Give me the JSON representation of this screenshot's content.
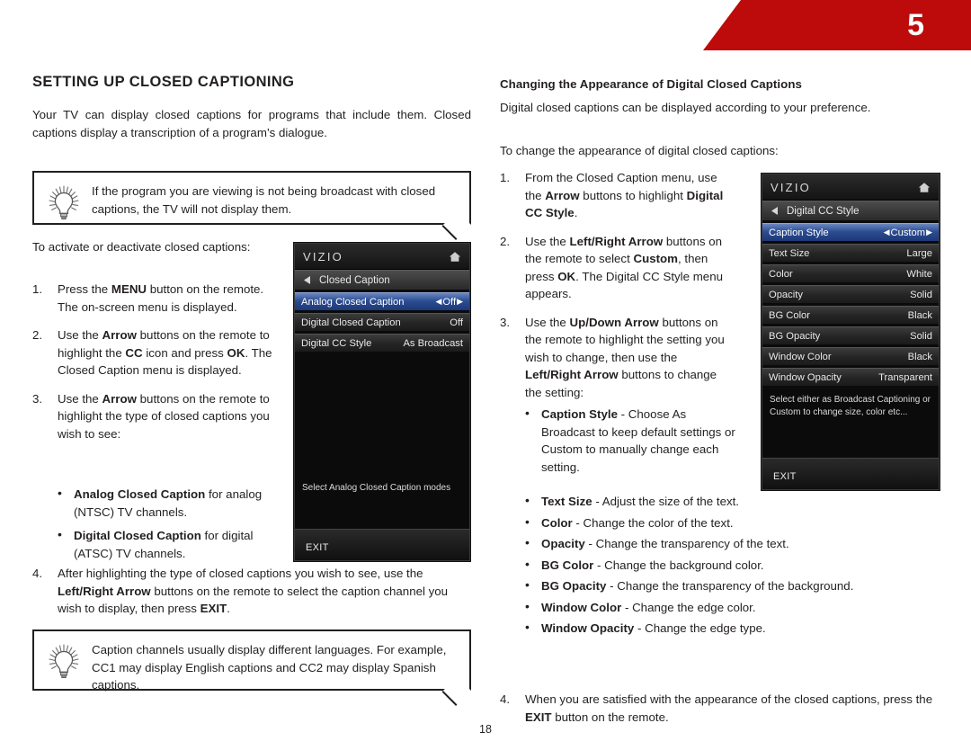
{
  "banner": {
    "chapter_number": "5",
    "color": "#bd0a0a"
  },
  "page_number": "18",
  "left_column": {
    "section_title": "SETTING UP CLOSED CAPTIONING",
    "intro": "Your TV can display closed captions for programs that include them. Closed captions display a transcription of a program’s dialogue.",
    "tip1": "If the program you are viewing is not being broadcast with closed captions, the TV will not display them.",
    "lead_in": "To activate or deactivate closed captions:",
    "steps": [
      {
        "num": "1.",
        "html": "Press the <b>MENU</b> button on the remote. The on-screen menu is displayed."
      },
      {
        "num": "2.",
        "html": "Use the <b>Arrow</b> buttons on the remote to highlight the <b>CC</b> icon and press <b>OK</b>. The Closed Caption menu is displayed."
      },
      {
        "num": "3.",
        "html": "Use the <b>Arrow</b> buttons on the remote to highlight the type of closed captions you wish to see:"
      }
    ],
    "sub_bullets": [
      {
        "html": "<b>Analog Closed Caption</b> for analog (NTSC) TV channels."
      },
      {
        "html": "<b>Digital Closed Caption</b> for digital (ATSC) TV channels."
      }
    ],
    "step4": {
      "num": "4.",
      "html": "After highlighting the type of closed captions you wish to see, use the <b>Left/Right Arrow</b> buttons on the remote to select the caption channel you wish to display, then press <b>EXIT</b>."
    },
    "tip2": "Caption channels usually display different languages. For example, CC1 may display English captions and CC2 may display Spanish captions."
  },
  "right_column": {
    "sub_title": "Changing the Appearance of Digital Closed Captions",
    "intro": "Digital closed captions can be displayed according to your preference.",
    "lead_in": "To change the appearance of digital closed captions:",
    "steps": [
      {
        "num": "1.",
        "html": "From the Closed Caption menu, use the <b>Arrow</b> buttons to highlight <b>Digital CC Style</b>."
      },
      {
        "num": "2.",
        "html": "Use the <b>Left/Right Arrow</b> buttons on the remote to select <b>Custom</b>, then press <b>OK</b>. The Digital CC Style menu appears."
      },
      {
        "num": "3.",
        "html": "Use the <b>Up/Down Arrow</b> buttons on the remote to highlight the setting you wish to change, then use the <b>Left/Right Arrow</b> buttons to change the setting:"
      }
    ],
    "setting_bullets_narrow": [
      {
        "html": "<b>Caption Style</b> - Choose As Broadcast to keep default settings or Custom to manually change each setting."
      }
    ],
    "setting_bullets_wide": [
      {
        "html": "<b>Text Size</b> - Adjust the size of the text."
      },
      {
        "html": "<b>Color</b> - Change the color of the text."
      },
      {
        "html": "<b>Opacity</b> - Change the transparency of the text."
      },
      {
        "html": "<b>BG Color</b> - Change the background color."
      },
      {
        "html": "<b>BG Opacity</b> - Change the transparency of the background."
      },
      {
        "html": "<b>Window Color</b> - Change the edge color."
      },
      {
        "html": "<b>Window Opacity</b> - Change the edge type."
      }
    ],
    "step4": {
      "num": "4.",
      "html": "When you are satisfied with the appearance of the closed captions, press the <b>EXIT</b> button on the remote."
    }
  },
  "osd_closed_caption": {
    "brand": "VIZIO",
    "breadcrumb": "Closed Caption",
    "rows": [
      {
        "label": "Analog Closed Caption",
        "value": "Off",
        "selected": true
      },
      {
        "label": "Digital Closed Caption",
        "value": "Off",
        "selected": false
      },
      {
        "label": "Digital CC Style",
        "value": "As Broadcast",
        "selected": false
      }
    ],
    "hint": "Select Analog Closed Caption modes",
    "exit_label": "EXIT"
  },
  "osd_digital_cc_style": {
    "brand": "VIZIO",
    "breadcrumb": "Digital CC Style",
    "rows": [
      {
        "label": "Caption Style",
        "value": "Custom",
        "selected": true
      },
      {
        "label": "Text Size",
        "value": "Large",
        "selected": false
      },
      {
        "label": "Color",
        "value": "White",
        "selected": false
      },
      {
        "label": "Opacity",
        "value": "Solid",
        "selected": false
      },
      {
        "label": "BG Color",
        "value": "Black",
        "selected": false
      },
      {
        "label": "BG Opacity",
        "value": "Solid",
        "selected": false
      },
      {
        "label": "Window Color",
        "value": "Black",
        "selected": false
      },
      {
        "label": "Window Opacity",
        "value": "Transparent",
        "selected": false
      }
    ],
    "hint": "Select either as Broadcast Captioning or Custom to change size, color etc...",
    "exit_label": "EXIT"
  }
}
